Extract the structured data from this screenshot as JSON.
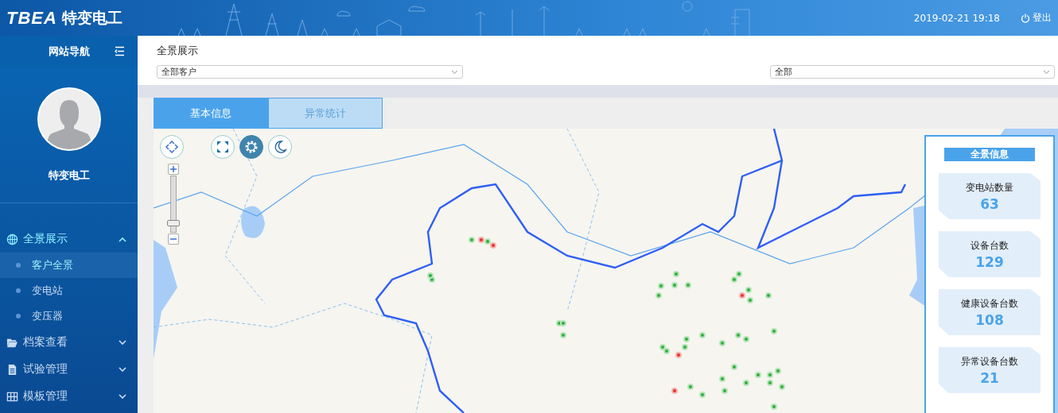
{
  "header": {
    "logo": "TBEA",
    "brand": "特变电工",
    "datetime": "2019-02-21 19:18",
    "logout": "登出"
  },
  "sidebar": {
    "title": "网站导航",
    "user_name": "特变电工",
    "menu": [
      {
        "label": "全景展示",
        "expanded": true,
        "children": [
          {
            "label": "客户全景",
            "selected": true
          },
          {
            "label": "变电站",
            "selected": false
          },
          {
            "label": "变压器",
            "selected": false
          }
        ]
      },
      {
        "label": "档案查看",
        "expanded": false
      },
      {
        "label": "试验管理",
        "expanded": false
      },
      {
        "label": "模板管理",
        "expanded": false
      }
    ]
  },
  "page": {
    "title": "全景展示",
    "filters": [
      {
        "value": "全部客户"
      },
      {
        "value": "全部"
      }
    ]
  },
  "tabs": [
    {
      "label": "基本信息",
      "selected": true
    },
    {
      "label": "异常统计",
      "selected": false
    }
  ],
  "map": {
    "zoom_slider": {
      "level": 0.1
    }
  },
  "summary": {
    "title": "全景信息",
    "cards": [
      {
        "label": "变电站数量",
        "value": "63"
      },
      {
        "label": "设备台数",
        "value": "129"
      },
      {
        "label": "健康设备台数",
        "value": "108"
      },
      {
        "label": "异常设备台数",
        "value": "21"
      }
    ]
  }
}
